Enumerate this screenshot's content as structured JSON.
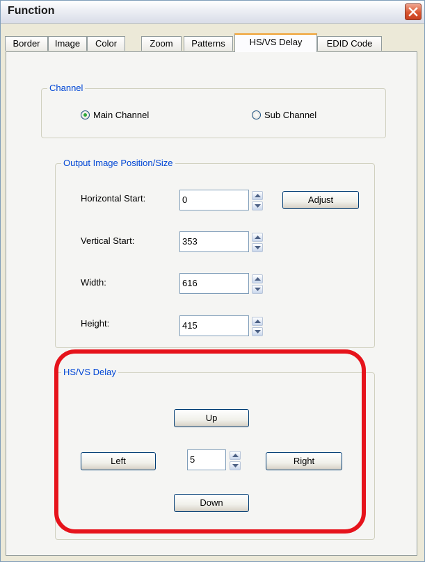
{
  "window": {
    "title": "Function"
  },
  "tabs": [
    {
      "label": "Border"
    },
    {
      "label": "Image"
    },
    {
      "label": "Color"
    },
    {
      "label": "Zoom"
    },
    {
      "label": "Patterns"
    },
    {
      "label": "HS/VS Delay"
    },
    {
      "label": "EDID Code"
    }
  ],
  "active_tab": "HS/VS Delay",
  "channel": {
    "legend": "Channel",
    "main_label": "Main Channel",
    "sub_label": "Sub Channel",
    "selected": "Main Channel"
  },
  "output": {
    "legend": "Output Image Position/Size",
    "fields": [
      {
        "label": "Horizontal Start:",
        "value": "0"
      },
      {
        "label": "Vertical Start:",
        "value": "353"
      },
      {
        "label": "Width:",
        "value": "616"
      },
      {
        "label": "Height:",
        "value": "415"
      }
    ],
    "adjust_label": "Adjust"
  },
  "delay": {
    "legend": "HS/VS Delay",
    "up_label": "Up",
    "down_label": "Down",
    "left_label": "Left",
    "right_label": "Right",
    "step_value": "5"
  },
  "colors": {
    "highlight": "#e6131b",
    "legend_text": "#0046d5"
  }
}
